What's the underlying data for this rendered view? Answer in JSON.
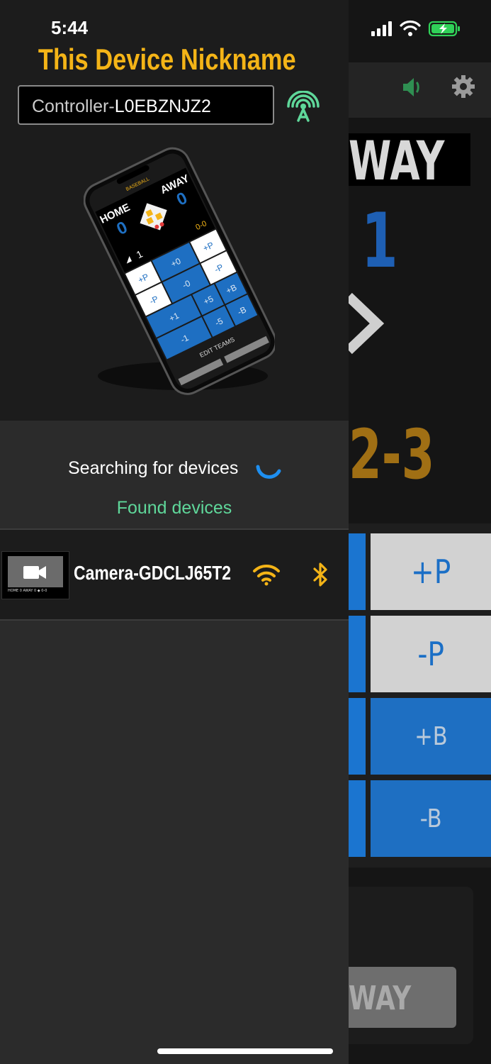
{
  "status_bar": {
    "time": "5:44"
  },
  "drawer": {
    "title": "This Device Nickname",
    "nickname_prefix": "Controller-",
    "nickname_value": "L0EBZNJZ2",
    "searching_text": "Searching for devices",
    "found_text": "Found devices",
    "devices": [
      {
        "name": "Camera-GDCLJ65T2",
        "thumb_strip": "HOME 0 AWAY 0 ◆ 0-0"
      }
    ]
  },
  "illustration": {
    "sport": "BASEBALL",
    "home": "HOME",
    "away": "AWAY",
    "home_score": "0",
    "away_score": "0",
    "inning": "1",
    "count": "0-0",
    "buttons": [
      "+P",
      "+0",
      "+P",
      "-P",
      "-0",
      "-P",
      "+1",
      "+5",
      "+B",
      "-1",
      "-5",
      "-B"
    ],
    "edit_teams": "EDIT TEAMS"
  },
  "background_app": {
    "away_label": "WAY",
    "away_score": "1",
    "count": "2-3",
    "buttons": [
      "+P",
      "-P",
      "+B",
      "-B"
    ],
    "away_button": "WAY"
  },
  "colors": {
    "accent": "#f4b417",
    "found": "#5fd79a",
    "blue": "#1e6fc2"
  }
}
